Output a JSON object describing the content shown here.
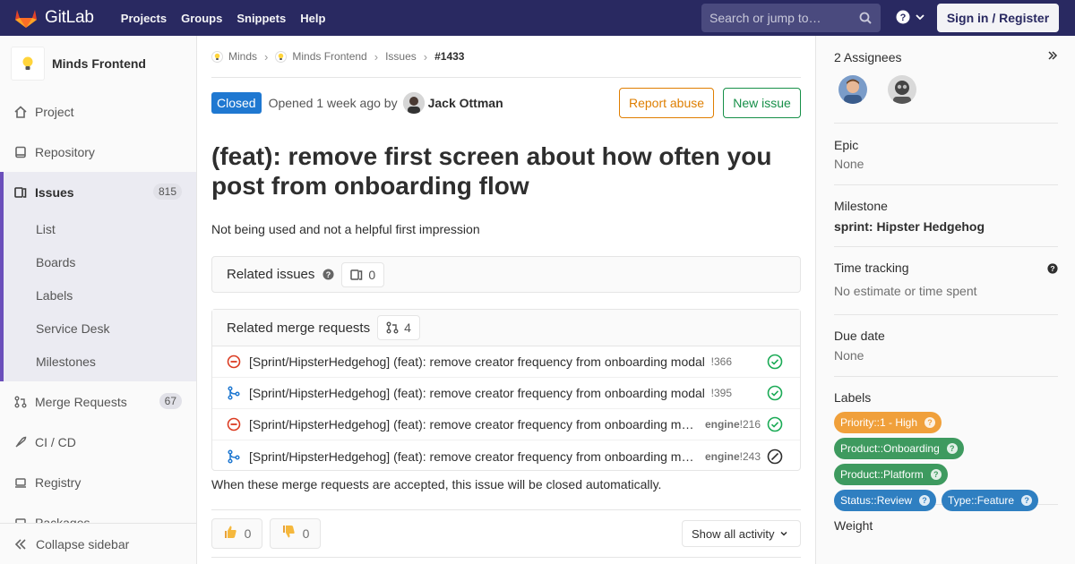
{
  "navbar": {
    "brand": "GitLab",
    "links": [
      "Projects",
      "Groups",
      "Snippets",
      "Help"
    ],
    "search_placeholder": "Search or jump to…",
    "signin": "Sign in / Register"
  },
  "sidebar": {
    "project_name": "Minds Frontend",
    "items": [
      {
        "label": "Project",
        "icon": "home-icon"
      },
      {
        "label": "Repository",
        "icon": "repository-icon"
      },
      {
        "label": "Issues",
        "icon": "issues-icon",
        "count": "815"
      },
      {
        "label": "Merge Requests",
        "icon": "merge-request-icon",
        "count": "67"
      },
      {
        "label": "CI / CD",
        "icon": "rocket-icon"
      },
      {
        "label": "Registry",
        "icon": "registry-icon"
      },
      {
        "label": "Packages",
        "icon": "package-icon"
      }
    ],
    "issues_sub": [
      "List",
      "Boards",
      "Labels",
      "Service Desk",
      "Milestones"
    ],
    "collapse": "Collapse sidebar"
  },
  "breadcrumb": [
    "Minds",
    "Minds Frontend",
    "Issues",
    "#1433"
  ],
  "issue": {
    "status": "Closed",
    "opened_text": "Opened 1 week ago by",
    "author": "Jack Ottman",
    "report_abuse": "Report abuse",
    "new_issue": "New issue",
    "title": "(feat): remove first screen about how often you post from onboarding flow",
    "description": "Not being used and not a helpful first impression"
  },
  "related_issues": {
    "label": "Related issues",
    "count": "0"
  },
  "related_mrs": {
    "label": "Related merge requests",
    "count": "4",
    "items": [
      {
        "title": "[Sprint/HipsterHedgehog] (feat): remove creator frequency from onboarding modal",
        "project": "",
        "ref": "!366",
        "state": "closed",
        "pipeline": "passed"
      },
      {
        "title": "[Sprint/HipsterHedgehog] (feat): remove creator frequency from onboarding modal",
        "project": "",
        "ref": "!395",
        "state": "merged",
        "pipeline": "passed"
      },
      {
        "title": "[Sprint/HipsterHedgehog] (feat): remove creator frequency from onboarding m…",
        "project": "engine",
        "ref": "!216",
        "state": "closed",
        "pipeline": "passed"
      },
      {
        "title": "[Sprint/HipsterHedgehog] (feat): remove creator frequency from onboarding m…",
        "project": "engine",
        "ref": "!243",
        "state": "merged",
        "pipeline": "skipped"
      }
    ],
    "footer": "When these merge requests are accepted, this issue will be closed automatically."
  },
  "awards": {
    "thumbsup": "0",
    "thumbsdown": "0"
  },
  "activity_filter": "Show all activity",
  "right": {
    "assignees_title": "2 Assignees",
    "epic_title": "Epic",
    "epic_value": "None",
    "milestone_title": "Milestone",
    "milestone_value": "sprint: Hipster Hedgehog",
    "time_title": "Time tracking",
    "time_value": "No estimate or time spent",
    "due_title": "Due date",
    "due_value": "None",
    "labels_title": "Labels",
    "labels": [
      {
        "text": "Priority::1 - High",
        "color": "#f0a03b"
      },
      {
        "text": "Product::Onboarding",
        "color": "#3e9a5f"
      },
      {
        "text": "Product::Platform",
        "color": "#3e9a5f"
      },
      {
        "text": "Status::Review",
        "color": "#2f7fc1"
      },
      {
        "text": "Type::Feature",
        "color": "#2f7fc1"
      }
    ],
    "weight_title": "Weight"
  }
}
